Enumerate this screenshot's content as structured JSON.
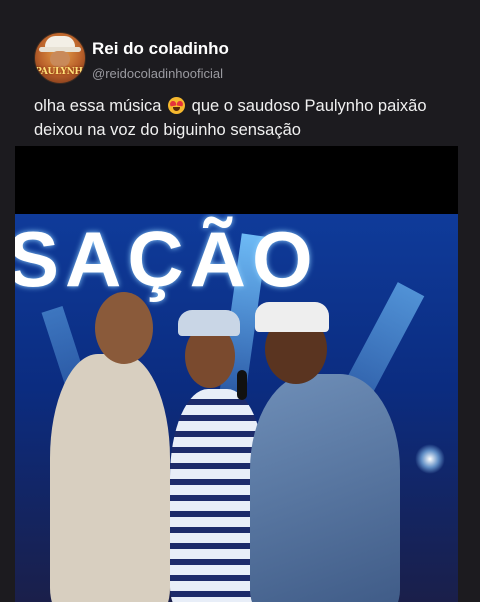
{
  "post": {
    "display_name": "Rei do coladinho",
    "handle": "@reidocoladinhooficial",
    "avatar_logo_text": "PAULYNHO",
    "caption_before_emoji": "olha essa música",
    "emoji": "smiling-face-with-heart-eyes",
    "caption_after_emoji": "que o saudoso Paulynho paixão deixou na voz do biguinho sensação"
  },
  "video": {
    "led_screen_text": "SAÇÃO"
  }
}
